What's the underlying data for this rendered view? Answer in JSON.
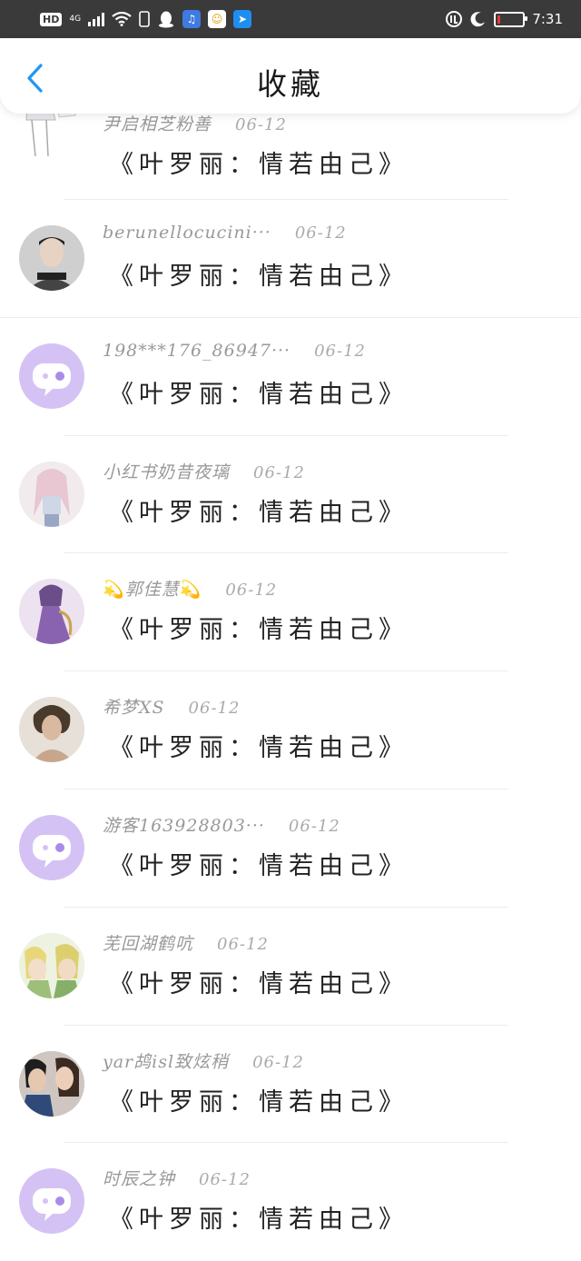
{
  "status_bar": {
    "network": "HD",
    "network_type": "4G",
    "time": "7:31"
  },
  "header": {
    "title": "收藏"
  },
  "favorites": [
    {
      "user": "尹启相芝粉善",
      "date": "06-12",
      "book": "《叶罗丽：情若由己》",
      "avatar": "anime-girl"
    },
    {
      "user": "berunellocucini···",
      "date": "06-12",
      "book": "《叶罗丽：情若由己》",
      "avatar": "photo-boy"
    },
    {
      "user": "198***176_86947···",
      "date": "06-12",
      "book": "《叶罗丽：情若由己》",
      "avatar": "default-chat"
    },
    {
      "user": "小红书奶昔夜璃",
      "date": "06-12",
      "book": "《叶罗丽：情若由己》",
      "avatar": "anime-girl"
    },
    {
      "user": "郭佳慧",
      "date": "06-12",
      "book": "《叶罗丽：情若由己》",
      "avatar": "anime-princess"
    },
    {
      "user": "希梦XS",
      "date": "06-12",
      "book": "《叶罗丽：情若由己》",
      "avatar": "portrait-woman"
    },
    {
      "user": "游客163928803···",
      "date": "06-12",
      "book": "《叶罗丽：情若由己》",
      "avatar": "default-chat"
    },
    {
      "user": "芜回湖鹤吭",
      "date": "06-12",
      "book": "《叶罗丽：情若由己》",
      "avatar": "anime-elves"
    },
    {
      "user": "yar鸪isl致炫稍",
      "date": "06-12",
      "book": "《叶罗丽：情若由己》",
      "avatar": "photo-couple"
    },
    {
      "user": "时辰之钟",
      "date": "06-12",
      "book": "《叶罗丽：情若由己》",
      "avatar": "default-chat"
    }
  ]
}
